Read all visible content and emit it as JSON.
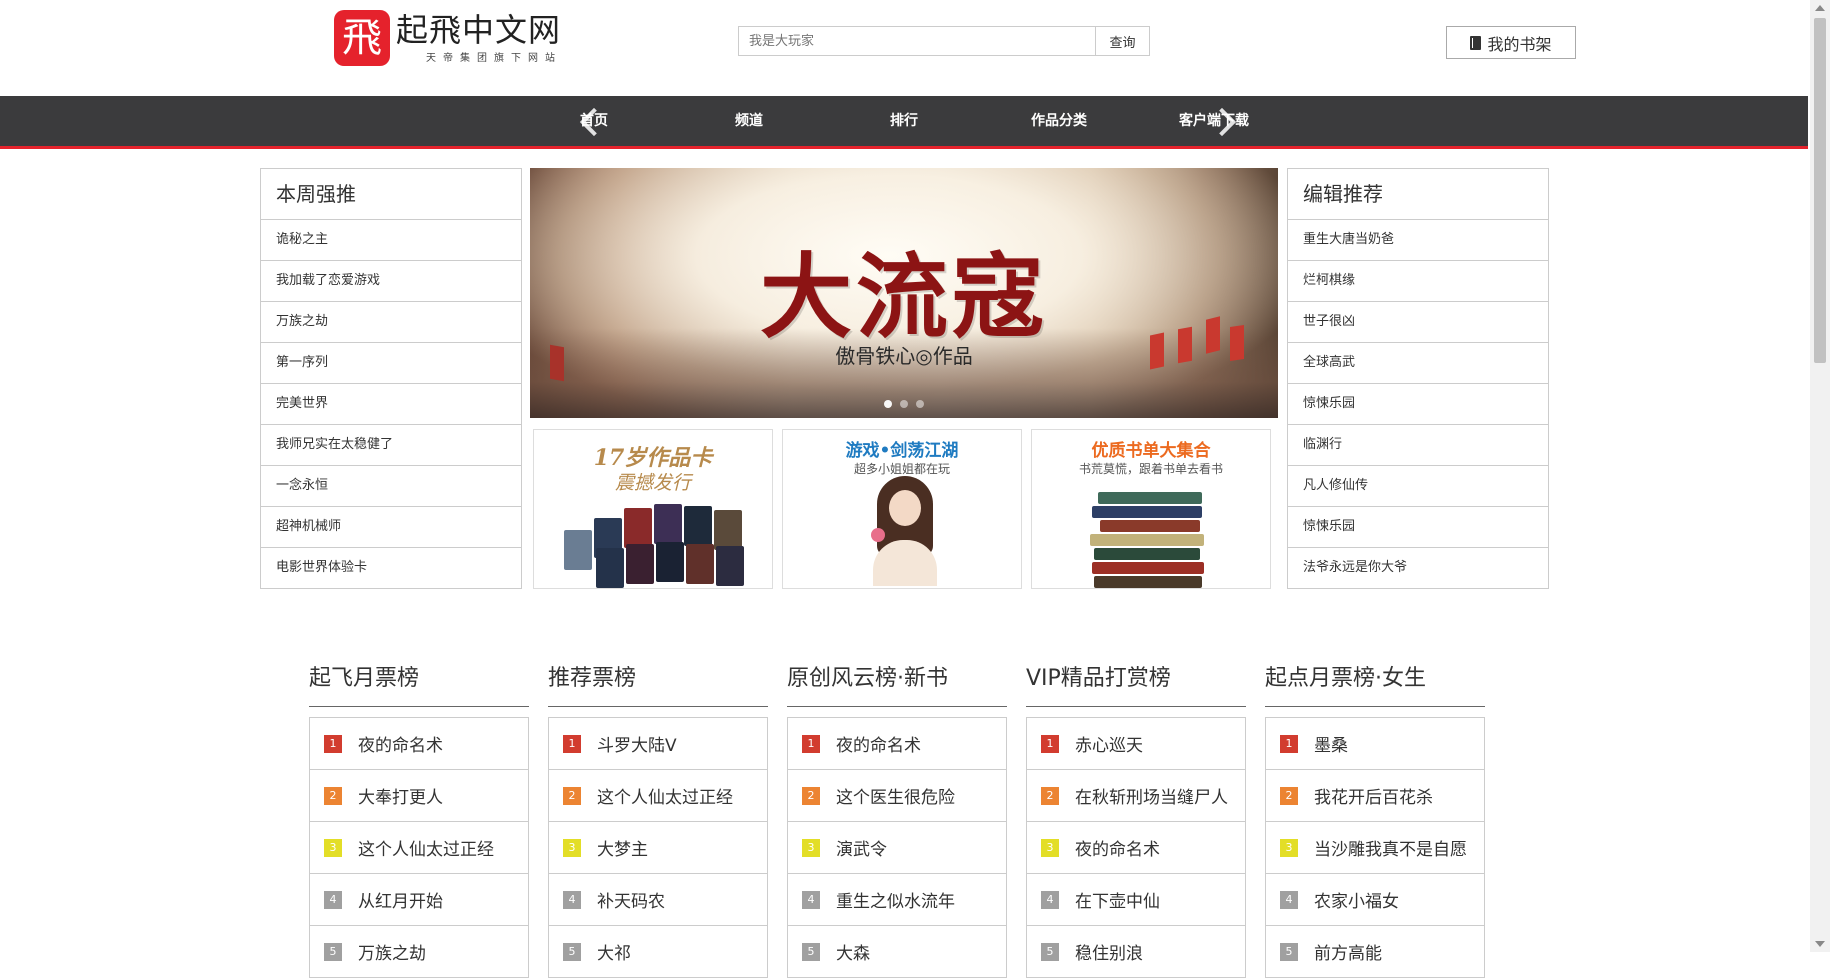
{
  "header": {
    "logo_char": "飛",
    "logo_title": "起飛中文网",
    "logo_slogan": "天帝集团旗下网站",
    "search_placeholder": "我是大玩家",
    "search_button": "查询",
    "shelf_button": "我的书架"
  },
  "nav": {
    "items": [
      "首页",
      "频道",
      "排行",
      "作品分类",
      "客户端下载"
    ]
  },
  "weekly": {
    "title": "本周强推",
    "items": [
      "诡秘之主",
      "我加载了恋爱游戏",
      "万族之劫",
      "第一序列",
      "完美世界",
      "我师兄实在太稳健了",
      "一念永恒",
      "超神机械师",
      "电影世界体验卡"
    ]
  },
  "banner": {
    "title": "大流寇",
    "author": "傲骨铁心◎作品"
  },
  "cards": [
    {
      "title": "17岁作品卡",
      "subtitle": "震撼发行"
    },
    {
      "title": "游戏•剑荡江湖",
      "subtitle": "超多小姐姐都在玩"
    },
    {
      "title": "优质书单大集合",
      "subtitle": "书荒莫慌，跟着书单去看书"
    }
  ],
  "editor": {
    "title": "编辑推荐",
    "items": [
      "重生大唐当奶爸",
      "烂柯棋缘",
      "世子很凶",
      "全球高武",
      "惊悚乐园",
      "临渊行",
      "凡人修仙传",
      "惊悚乐园",
      "法爷永远是你大爷"
    ]
  },
  "rankings": [
    {
      "title": "起飞月票榜",
      "items": [
        "夜的命名术",
        "大奉打更人",
        "这个人仙太过正经",
        "从红月开始",
        "万族之劫"
      ]
    },
    {
      "title": "推荐票榜",
      "items": [
        "斗罗大陆V",
        "这个人仙太过正经",
        "大梦主",
        "补天码农",
        "大祁"
      ]
    },
    {
      "title": "原创风云榜·新书",
      "items": [
        "夜的命名术",
        "这个医生很危险",
        "演武令",
        "重生之似水流年",
        "大森"
      ]
    },
    {
      "title": "VIP精品打赏榜",
      "items": [
        "赤心巡天",
        "在秋斩刑场当缝尸人",
        "夜的命名术",
        "在下壶中仙",
        "稳住别浪"
      ]
    },
    {
      "title": "起点月票榜·女生",
      "items": [
        "墨桑",
        "我花开后百花杀",
        "当沙雕我真不是自愿",
        "农家小福女",
        "前方高能"
      ]
    }
  ],
  "colors": {
    "brand_red": "#e5222c",
    "nav_bg": "#3b3b3d",
    "card_blue": "#1f7bc1",
    "card_orange": "#ec6a1f"
  }
}
